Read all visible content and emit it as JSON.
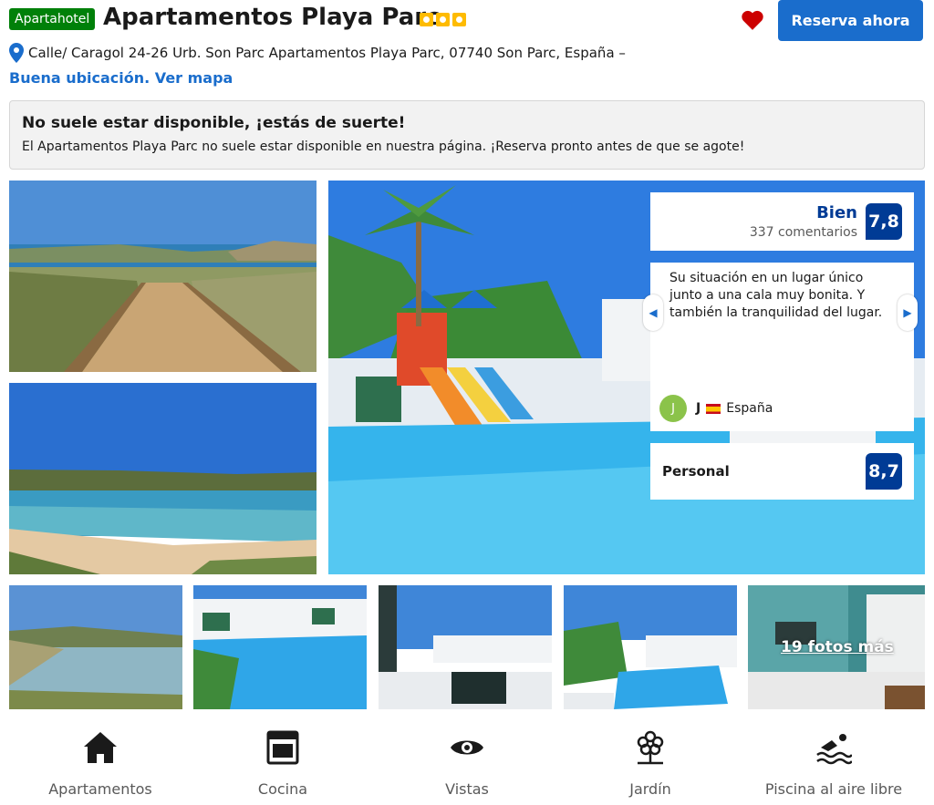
{
  "header": {
    "badge": "Apartahotel",
    "title": "Apartamentos Playa Parc",
    "stars": 3,
    "reserve_label": "Reserva ahora",
    "address": "Calle/ Caragol 24-26 Urb. Son Parc Apartamentos Playa Parc, 07740 Son Parc, España –",
    "map_link": "Buena ubicación. Ver mapa"
  },
  "alert": {
    "title": "No suele estar disponible, ¡estás de suerte!",
    "text": "El Apartamentos Playa Parc no suele estar disponible en nuestra página. ¡Reserva pronto antes de que se agote!"
  },
  "review": {
    "rating_word": "Bien",
    "review_count": "337 comentarios",
    "score": "7,8",
    "quote": "Su situación en un lugar único junto a una cala muy bonita. Y también la tranquilidad del lugar.",
    "reviewer_initial": "J",
    "reviewer_name": "J",
    "reviewer_country": "España",
    "category_label": "Personal",
    "category_score": "8,7"
  },
  "gallery": {
    "more_photos": "19 fotos más"
  },
  "amenities": [
    {
      "label": "Apartamentos",
      "icon": "house-icon"
    },
    {
      "label": "Cocina",
      "icon": "oven-icon"
    },
    {
      "label": "Vistas",
      "icon": "eye-icon"
    },
    {
      "label": "Jardín",
      "icon": "flower-icon"
    },
    {
      "label": "Piscina al aire libre",
      "icon": "swimmer-icon"
    }
  ],
  "colors": {
    "brand_blue": "#1a6dcc",
    "score_blue": "#003b95",
    "badge_green": "#008009",
    "star_yellow": "#febb02",
    "heart_red": "#cc0000"
  }
}
